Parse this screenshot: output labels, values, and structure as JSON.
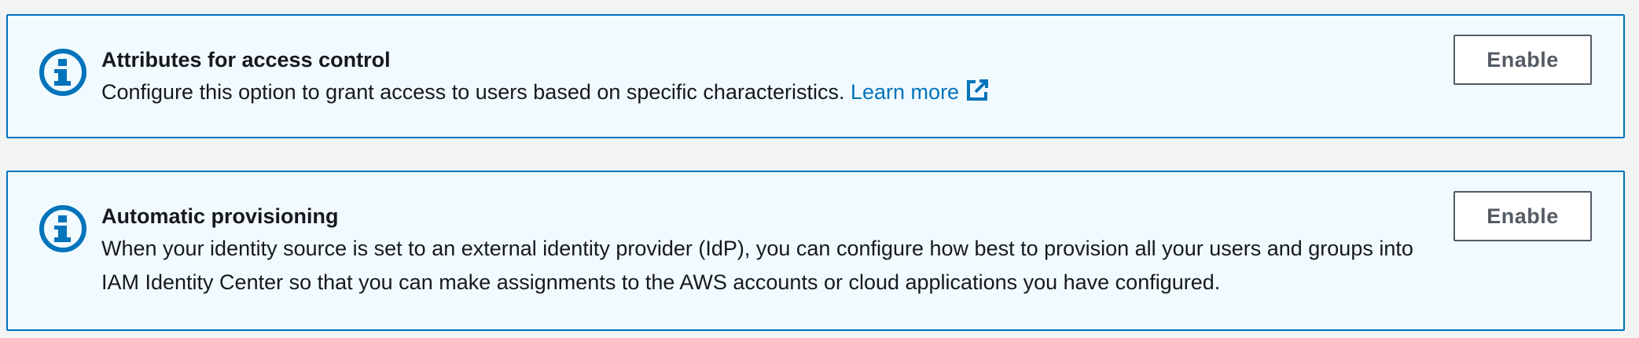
{
  "colors": {
    "page_background": "#f2f3f3",
    "alert_background": "#f1faff",
    "alert_border": "#0073bb",
    "link": "#0073bb",
    "button_border": "#545b64",
    "button_text": "#545b64",
    "text": "#16191f"
  },
  "alerts": [
    {
      "icon": "info-icon",
      "title": "Attributes for access control",
      "message": "Configure this option to grant access to users based on specific characteristics.",
      "link_label": "Learn more",
      "link_icon": "external-link-icon",
      "button_label": "Enable"
    },
    {
      "icon": "info-icon",
      "title": "Automatic provisioning",
      "message": "When your identity source is set to an external identity provider (IdP), you can configure how best to provision all your users and groups into IAM Identity Center so that you can make assignments to the AWS accounts or cloud applications you have configured.",
      "button_label": "Enable"
    }
  ]
}
